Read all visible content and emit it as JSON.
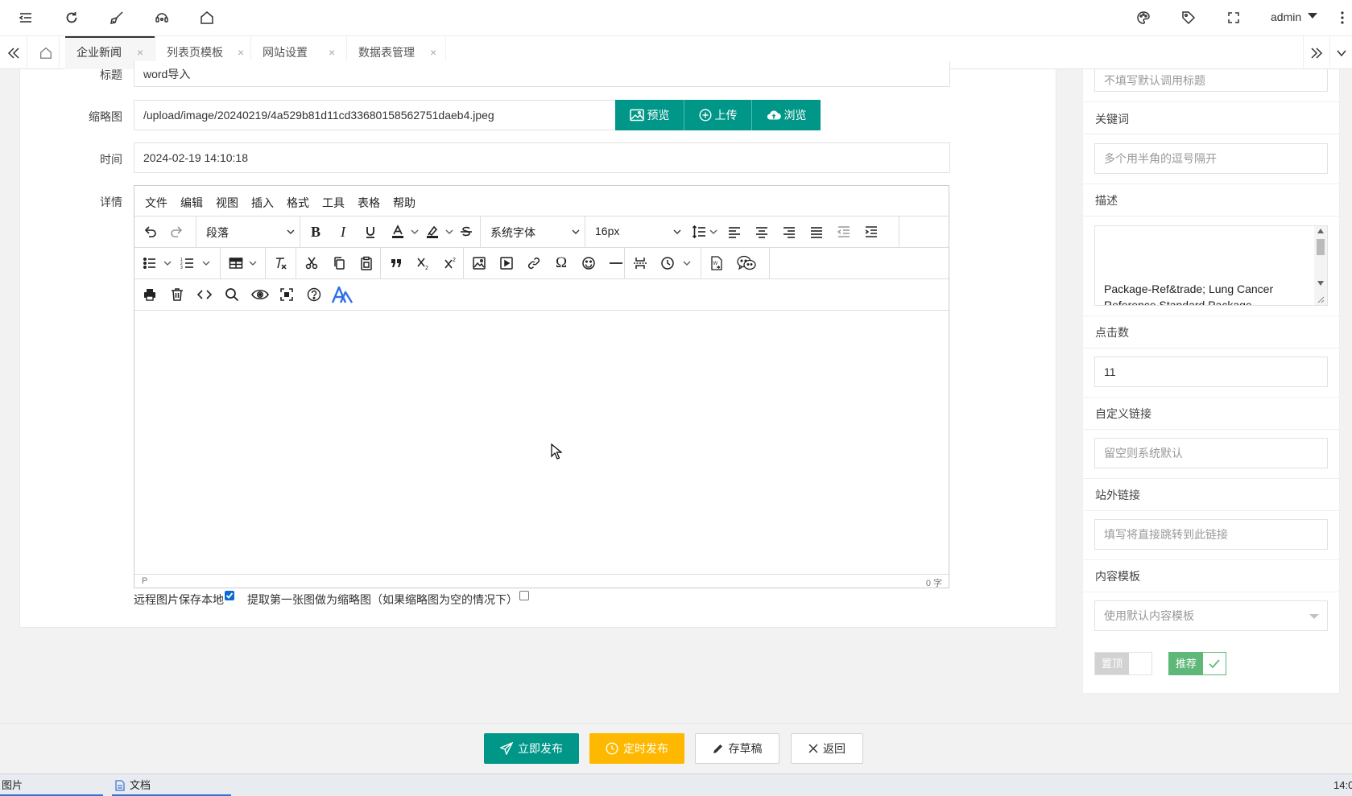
{
  "topbar": {
    "icons": [
      "menu-fold-icon",
      "refresh-icon",
      "brush-icon",
      "headset-icon",
      "home-icon",
      "theme-icon",
      "tag-icon",
      "fullscreen-icon",
      "more-vertical-icon"
    ],
    "user": "admin"
  },
  "tabs": [
    {
      "label": "企业新闻",
      "active": true
    },
    {
      "label": "列表页模板",
      "active": false
    },
    {
      "label": "网站设置",
      "active": false
    },
    {
      "label": "数据表管理",
      "active": false
    }
  ],
  "tab_close": "×",
  "form": {
    "title_label": "标题",
    "title_value": "word导入",
    "thumb_label": "缩略图",
    "thumb_value": "/upload/image/20240219/4a529b81d11cd33680158562751daeb4.jpeg",
    "btn_preview": "预览",
    "btn_upload": "上传",
    "btn_browse": "浏览",
    "time_label": "时间",
    "time_value": "2024-02-19 14:10:18",
    "detail_label": "详情"
  },
  "editor": {
    "menu": [
      "文件",
      "编辑",
      "视图",
      "插入",
      "格式",
      "工具",
      "表格",
      "帮助"
    ],
    "block_format": "段落",
    "font_family": "系统字体",
    "font_size": "16px",
    "status_path": "P",
    "word_count": "0 字"
  },
  "checks": {
    "save_remote_label": "远程图片保存本地",
    "save_remote_checked": true,
    "first_image_label": "提取第一张图做为缩略图（如果缩略图为空的情况下）",
    "first_image_checked": false
  },
  "side": {
    "title_placeholder": "不填写默认调用标题",
    "keywords_label": "关键词",
    "keywords_placeholder": "多个用半角的逗号隔开",
    "desc_label": "描述",
    "desc_value_line1": "Package-Ref&trade; Lung Cancer",
    "desc_value_line2": "Reference Standard Package",
    "hits_label": "点击数",
    "hits_value": "11",
    "custom_link_label": "自定义链接",
    "custom_link_placeholder": "留空则系统默认",
    "external_link_label": "站外链接",
    "external_link_placeholder": "填写将直接跳转到此链接",
    "template_label": "内容模板",
    "template_value": "使用默认内容模板",
    "top_label": "置顶",
    "top_on": false,
    "recommend_label": "推荐",
    "recommend_on": true
  },
  "actions": {
    "publish": "立即发布",
    "schedule": "定时发布",
    "draft": "存草稿",
    "back": "返回"
  },
  "taskbar": {
    "item1": "图片",
    "item2": "文档",
    "clock": "14:0"
  },
  "colors": {
    "primary": "#009688",
    "warn": "#ffb800",
    "switch_on": "#5fb878",
    "switch_off": "#d2d2d2",
    "checkbox": "#0b6bd6"
  }
}
